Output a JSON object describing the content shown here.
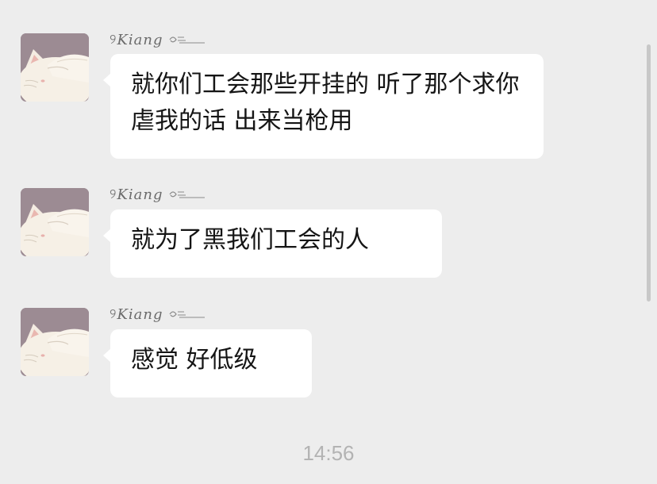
{
  "messages": [
    {
      "sender": "Kiang",
      "sender_decor_left": "୨",
      "avatar_icon": "cat-covering-face-avatar",
      "text": "就你们工会那些开挂的  听了那个求你虐我的话  出来当枪用"
    },
    {
      "sender": "Kiang",
      "sender_decor_left": "୨",
      "avatar_icon": "cat-covering-face-avatar",
      "text": "就为了黑我们工会的人"
    },
    {
      "sender": "Kiang",
      "sender_decor_left": "୨",
      "avatar_icon": "cat-covering-face-avatar",
      "text": "感觉  好低级"
    }
  ],
  "timestamp": "14:56",
  "colors": {
    "background": "#ededed",
    "bubble": "#ffffff",
    "text": "#151515",
    "timestamp": "#b3b3b3"
  }
}
